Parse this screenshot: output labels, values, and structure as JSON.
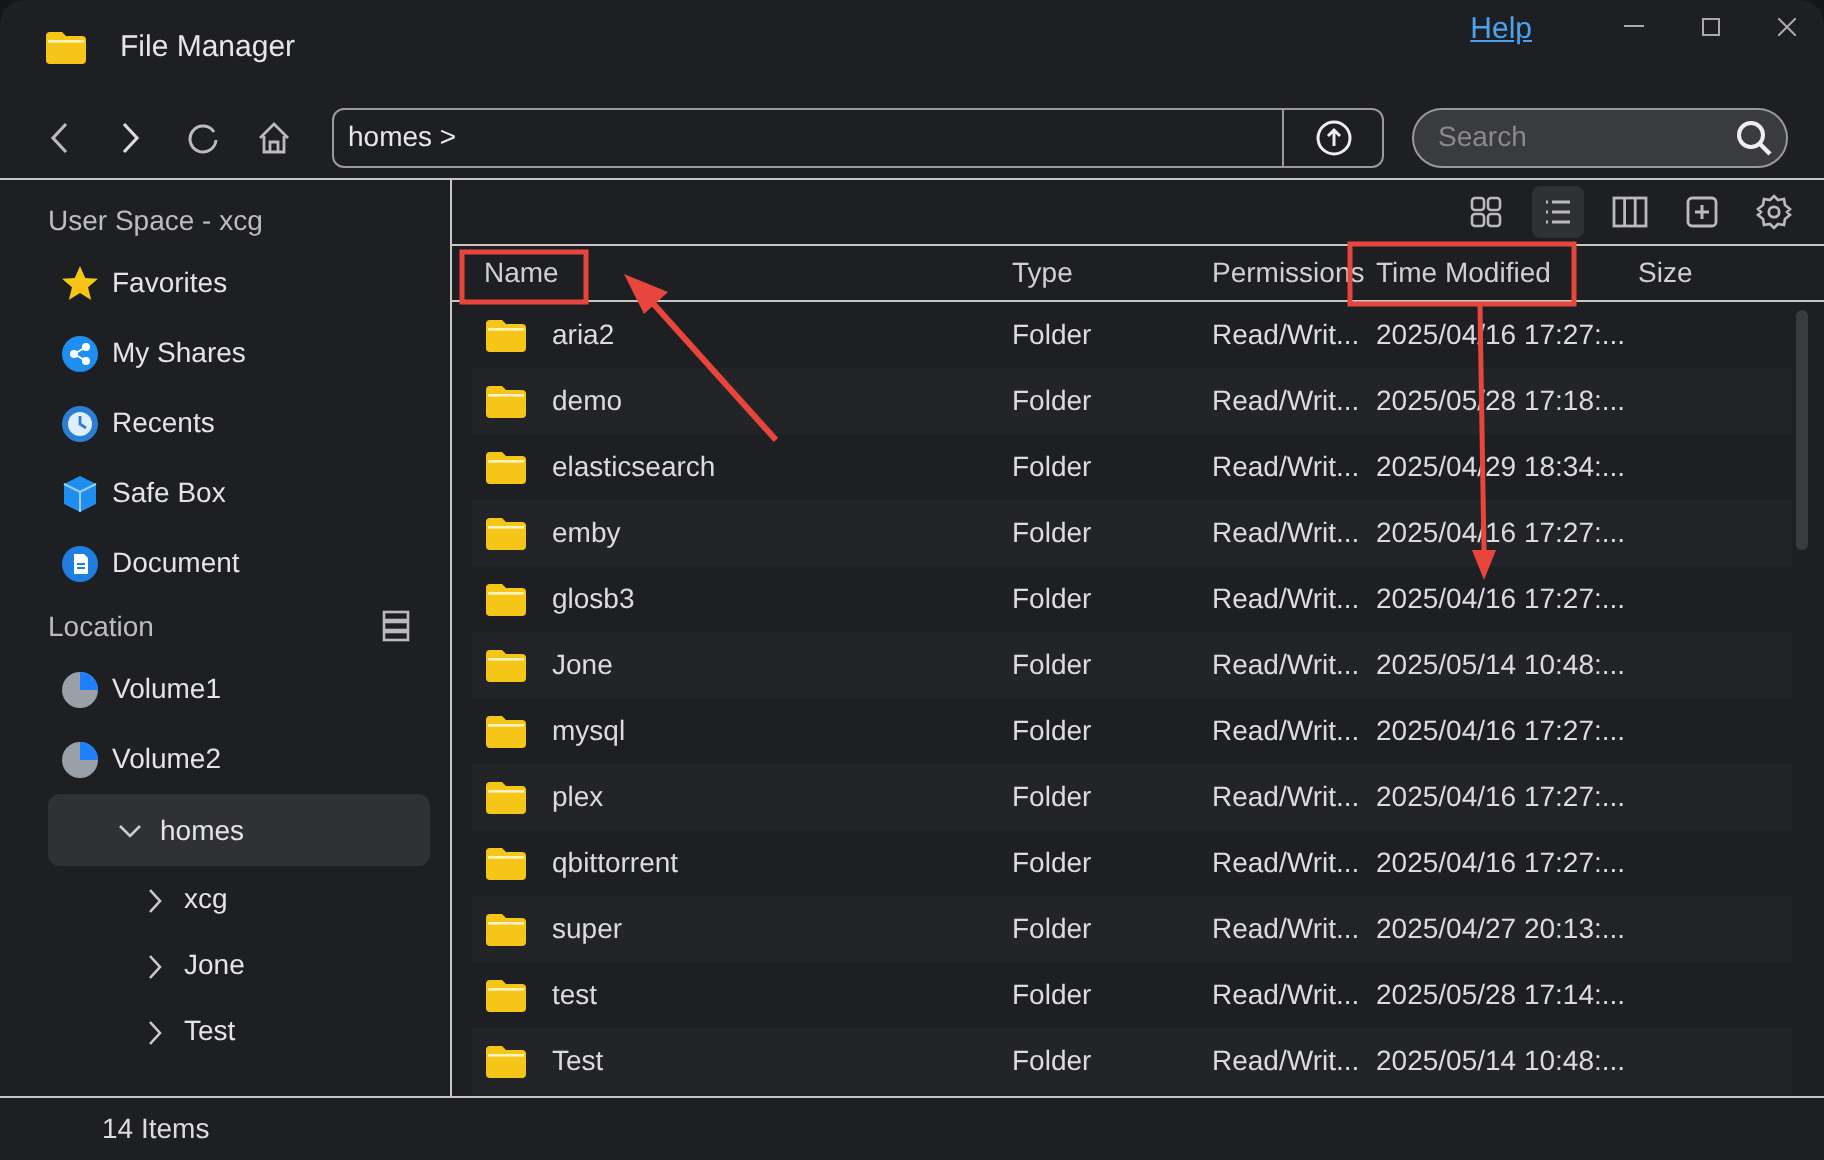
{
  "window": {
    "title": "File Manager",
    "help_link": "Help"
  },
  "toolbar": {
    "path": "homes",
    "path_separator": ">",
    "search": {
      "placeholder": "Search"
    }
  },
  "sidebar": {
    "heading": "User Space - xcg",
    "items": [
      {
        "label": "Favorites",
        "kind": "favorites"
      },
      {
        "label": "My Shares",
        "kind": "shares"
      },
      {
        "label": "Recents",
        "kind": "recents"
      },
      {
        "label": "Safe Box",
        "kind": "safebox"
      },
      {
        "label": "Document",
        "kind": "document"
      }
    ],
    "location_heading": "Location",
    "volumes": [
      {
        "label": "Volume1"
      },
      {
        "label": "Volume2"
      }
    ],
    "tree": [
      {
        "label": "homes",
        "expanded": true,
        "selected": true,
        "children": [
          {
            "label": "xcg",
            "expanded": false,
            "selected": false
          },
          {
            "label": "Jone",
            "expanded": false,
            "selected": false
          },
          {
            "label": "Test",
            "expanded": false,
            "selected": false
          }
        ]
      }
    ]
  },
  "view_buttons": [
    {
      "kind": "grid",
      "selected": false
    },
    {
      "kind": "list",
      "selected": true
    },
    {
      "kind": "columns",
      "selected": false
    },
    {
      "kind": "new",
      "selected": false
    },
    {
      "kind": "settings",
      "selected": false
    }
  ],
  "table": {
    "columns": [
      "Name",
      "Type",
      "Permissions",
      "Time Modified",
      "Size"
    ],
    "rows": [
      {
        "name": "aria2",
        "type": "Folder",
        "permissions": "Read/Writ...",
        "modified": "2025/04/16 17:27:..."
      },
      {
        "name": "demo",
        "type": "Folder",
        "permissions": "Read/Writ...",
        "modified": "2025/05/28 17:18:..."
      },
      {
        "name": "elasticsearch",
        "type": "Folder",
        "permissions": "Read/Writ...",
        "modified": "2025/04/29 18:34:..."
      },
      {
        "name": "emby",
        "type": "Folder",
        "permissions": "Read/Writ...",
        "modified": "2025/04/16 17:27:..."
      },
      {
        "name": "glosb3",
        "type": "Folder",
        "permissions": "Read/Writ...",
        "modified": "2025/04/16 17:27:..."
      },
      {
        "name": "Jone",
        "type": "Folder",
        "permissions": "Read/Writ...",
        "modified": "2025/05/14 10:48:..."
      },
      {
        "name": "mysql",
        "type": "Folder",
        "permissions": "Read/Writ...",
        "modified": "2025/04/16 17:27:..."
      },
      {
        "name": "plex",
        "type": "Folder",
        "permissions": "Read/Writ...",
        "modified": "2025/04/16 17:27:..."
      },
      {
        "name": "qbittorrent",
        "type": "Folder",
        "permissions": "Read/Writ...",
        "modified": "2025/04/16 17:27:..."
      },
      {
        "name": "super",
        "type": "Folder",
        "permissions": "Read/Writ...",
        "modified": "2025/04/27 20:13:..."
      },
      {
        "name": "test",
        "type": "Folder",
        "permissions": "Read/Writ...",
        "modified": "2025/05/28 17:14:..."
      },
      {
        "name": "Test",
        "type": "Folder",
        "permissions": "Read/Writ...",
        "modified": "2025/05/14 10:48:..."
      }
    ]
  },
  "status_bar": {
    "count": "14 Items"
  }
}
